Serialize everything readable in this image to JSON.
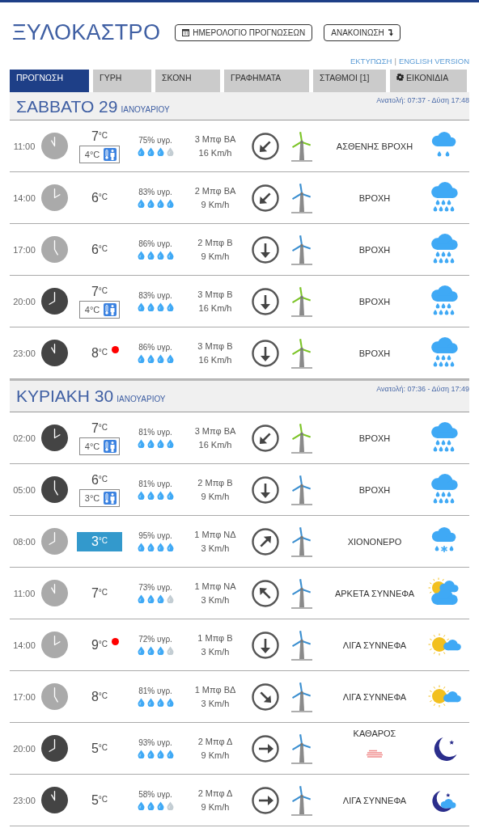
{
  "header": {
    "title": "ΞΥΛΟΚΑΣΤΡΟ",
    "buttons": [
      {
        "label": "ΗΜΕΡΟΛΟΓΙΟ ΠΡΟΓΝΩΣΕΩΝ",
        "kind": "calendar"
      },
      {
        "label": "ΑΝΑΚΟΙΝΩΣΗ",
        "kind": "arrow"
      }
    ],
    "links": [
      "ΕΚΤΥΠΩΣΗ",
      "|",
      "ENGLISH VERSION"
    ]
  },
  "tabs": [
    {
      "label": "ΠΡΟΓΝΩΣΗ",
      "selected": true
    },
    {
      "label": "ΓΥΡΗ",
      "selected": false
    },
    {
      "label": "ΣΚΟΝΗ",
      "selected": false
    },
    {
      "label": "ΓΡΑΦΗΜΑΤΑ",
      "selected": false
    },
    {
      "label": "ΣΤΑΘΜΟΙ [1]",
      "selected": false
    },
    {
      "label": "ΕΙΚΟΝΙΔΙΑ",
      "selected": false,
      "kind": "gear"
    }
  ],
  "days": [
    {
      "day": "ΣΑΒΒΑΤΟ 29",
      "month": "ΙΑΝΟΥΑΡΙΟΥ",
      "sun": "Ανατολή: 07:37  - Δύση 17:48",
      "rows": [
        {
          "time": "11:00",
          "night": false,
          "temp": "7",
          "unit": "°C",
          "feels": "4°C",
          "frost": false,
          "alert": false,
          "humidity": "75% υγρ.",
          "stars": 3,
          "wind": "3 Μπφ ΒΑ",
          "speed": "16 Km/h",
          "arrow": {
            "kind": "sw"
          },
          "color": "#7cc427",
          "condition": "ΑΣΘΕΝΗΣ ΒΡΟΧΗ",
          "kind": "light-rain",
          "haze": false
        },
        {
          "time": "14:00",
          "night": false,
          "temp": "6",
          "unit": "°C",
          "frost": false,
          "alert": false,
          "humidity": "83% υγρ.",
          "stars": 4,
          "wind": "2 Μπφ ΒΑ",
          "speed": "9 Km/h",
          "arrow": {
            "kind": "sw"
          },
          "color": "#3b8fd0",
          "condition": "ΒΡΟΧΗ",
          "kind": "rain",
          "haze": false
        },
        {
          "time": "17:00",
          "night": false,
          "temp": "6",
          "unit": "°C",
          "frost": false,
          "alert": false,
          "humidity": "86% υγρ.",
          "stars": 4,
          "wind": "2 Μπφ Β",
          "speed": "9 Km/h",
          "arrow": {
            "kind": "s"
          },
          "color": "#3b8fd0",
          "condition": "ΒΡΟΧΗ",
          "kind": "rain",
          "haze": false
        },
        {
          "time": "20:00",
          "night": true,
          "temp": "7",
          "unit": "°C",
          "feels": "4°C",
          "frost": false,
          "alert": false,
          "humidity": "83% υγρ.",
          "stars": 4,
          "wind": "3 Μπφ Β",
          "speed": "16 Km/h",
          "arrow": {
            "kind": "s"
          },
          "color": "#7cc427",
          "condition": "ΒΡΟΧΗ",
          "kind": "rain",
          "haze": false
        },
        {
          "time": "23:00",
          "night": true,
          "temp": "8",
          "unit": "°C",
          "frost": false,
          "alert": true,
          "humidity": "86% υγρ.",
          "stars": 4,
          "wind": "3 Μπφ Β",
          "speed": "16 Km/h",
          "arrow": {
            "kind": "s"
          },
          "color": "#7cc427",
          "condition": "ΒΡΟΧΗ",
          "kind": "rain",
          "haze": false
        }
      ]
    },
    {
      "day": "ΚΥΡΙΑΚΗ 30",
      "month": "ΙΑΝΟΥΑΡΙΟΥ",
      "sun": "Ανατολή: 07:36  - Δύση 17:49",
      "rows": [
        {
          "time": "02:00",
          "night": true,
          "temp": "7",
          "unit": "°C",
          "feels": "4°C",
          "frost": false,
          "alert": false,
          "humidity": "81% υγρ.",
          "stars": 4,
          "wind": "3 Μπφ ΒΑ",
          "speed": "16 Km/h",
          "arrow": {
            "kind": "sw"
          },
          "color": "#7cc427",
          "condition": "ΒΡΟΧΗ",
          "kind": "rain",
          "haze": false
        },
        {
          "time": "05:00",
          "night": true,
          "temp": "6",
          "unit": "°C",
          "feels": "3°C",
          "frost": false,
          "alert": false,
          "humidity": "81% υγρ.",
          "stars": 4,
          "wind": "2 Μπφ Β",
          "speed": "9 Km/h",
          "arrow": {
            "kind": "s"
          },
          "color": "#3b8fd0",
          "condition": "ΒΡΟΧΗ",
          "kind": "rain",
          "haze": false
        },
        {
          "time": "08:00",
          "night": false,
          "temp": "3",
          "unit": "°C",
          "frost": true,
          "alert": false,
          "humidity": "95% υγρ.",
          "stars": 4,
          "wind": "1 Μπφ ΝΔ",
          "speed": "3 Km/h",
          "arrow": {
            "kind": "ne"
          },
          "color": "#3b8fd0",
          "condition": "ΧΙΟΝΟΝΕΡΟ",
          "kind": "sleet",
          "haze": false
        },
        {
          "time": "11:00",
          "night": false,
          "temp": "7",
          "unit": "°C",
          "frost": false,
          "alert": false,
          "humidity": "73% υγρ.",
          "stars": 3,
          "wind": "1 Μπφ ΝΑ",
          "speed": "3 Km/h",
          "arrow": {
            "kind": "nw"
          },
          "color": "#3b8fd0",
          "condition": "ΑΡΚΕΤΑ ΣΥΝΝΕΦΑ",
          "kind": "mostly-cloudy",
          "haze": false
        },
        {
          "time": "14:00",
          "night": false,
          "temp": "9",
          "unit": "°C",
          "frost": false,
          "alert": true,
          "humidity": "72% υγρ.",
          "stars": 3,
          "wind": "1 Μπφ Β",
          "speed": "3 Km/h",
          "arrow": {
            "kind": "s"
          },
          "color": "#3b8fd0",
          "condition": "ΛΙΓΑ ΣΥΝΝΕΦΑ",
          "kind": "partly-cloudy",
          "haze": false
        },
        {
          "time": "17:00",
          "night": false,
          "temp": "8",
          "unit": "°C",
          "frost": false,
          "alert": false,
          "humidity": "81% υγρ.",
          "stars": 4,
          "wind": "1 Μπφ ΒΔ",
          "speed": "3 Km/h",
          "arrow": {
            "kind": "se"
          },
          "color": "#3b8fd0",
          "condition": "ΛΙΓΑ ΣΥΝΝΕΦΑ",
          "kind": "partly-cloudy",
          "haze": false
        },
        {
          "time": "20:00",
          "night": true,
          "temp": "5",
          "unit": "°C",
          "frost": false,
          "alert": false,
          "humidity": "93% υγρ.",
          "stars": 4,
          "wind": "2 Μπφ Δ",
          "speed": "9 Km/h",
          "arrow": {
            "kind": "e"
          },
          "color": "#3b8fd0",
          "condition": "ΚΑΘΑΡΟΣ",
          "kind": "clear-night",
          "haze": true
        },
        {
          "time": "23:00",
          "night": true,
          "temp": "5",
          "unit": "°C",
          "frost": false,
          "alert": false,
          "humidity": "58% υγρ.",
          "stars": 3,
          "wind": "2 Μπφ Δ",
          "speed": "9 Km/h",
          "arrow": {
            "kind": "e"
          },
          "color": "#3b8fd0",
          "condition": "ΛΙΓΑ ΣΥΝΝΕΦΑ",
          "kind": "night-cloudy",
          "haze": false
        }
      ]
    }
  ]
}
